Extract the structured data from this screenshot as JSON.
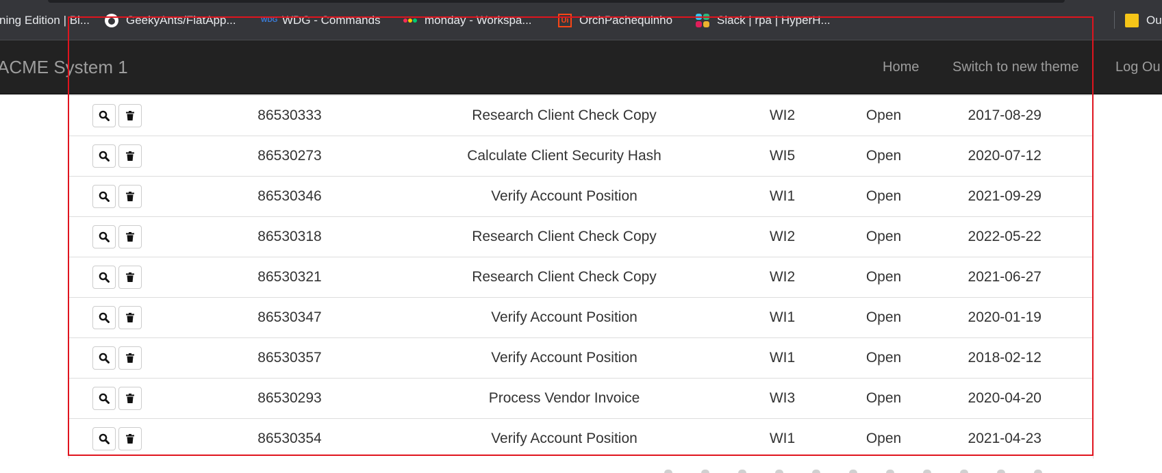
{
  "bookmarks": [
    {
      "label": "ning Edition | Bl...",
      "icon": "bookmark-icon"
    },
    {
      "label": "GeekyAnts/FlatApp...",
      "icon": "github-icon"
    },
    {
      "label": "WDG - Commands",
      "icon": "wdg-icon"
    },
    {
      "label": "monday - Workspa...",
      "icon": "monday-icon"
    },
    {
      "label": "OrchPachequinho",
      "icon": "uipath-icon"
    },
    {
      "label": "Slack | rpa | HyperH...",
      "icon": "slack-icon"
    },
    {
      "label": "Ou",
      "icon": "folder-icon"
    }
  ],
  "navbar": {
    "brand": "ACME System 1",
    "home": "Home",
    "switch_theme": "Switch to new theme",
    "logout": "Log Ou"
  },
  "rows": [
    {
      "id": "86530333",
      "description": "Research Client Check Copy",
      "type": "WI2",
      "status": "Open",
      "date": "2017-08-29"
    },
    {
      "id": "86530273",
      "description": "Calculate Client Security Hash",
      "type": "WI5",
      "status": "Open",
      "date": "2020-07-12"
    },
    {
      "id": "86530346",
      "description": "Verify Account Position",
      "type": "WI1",
      "status": "Open",
      "date": "2021-09-29"
    },
    {
      "id": "86530318",
      "description": "Research Client Check Copy",
      "type": "WI2",
      "status": "Open",
      "date": "2022-05-22"
    },
    {
      "id": "86530321",
      "description": "Research Client Check Copy",
      "type": "WI2",
      "status": "Open",
      "date": "2021-06-27"
    },
    {
      "id": "86530347",
      "description": "Verify Account Position",
      "type": "WI1",
      "status": "Open",
      "date": "2020-01-19"
    },
    {
      "id": "86530357",
      "description": "Verify Account Position",
      "type": "WI1",
      "status": "Open",
      "date": "2018-02-12"
    },
    {
      "id": "86530293",
      "description": "Process Vendor Invoice",
      "type": "WI3",
      "status": "Open",
      "date": "2020-04-20"
    },
    {
      "id": "86530354",
      "description": "Verify Account Position",
      "type": "WI1",
      "status": "Open",
      "date": "2021-04-23"
    }
  ],
  "colors": {
    "navbar_bg": "#222222",
    "bookmarks_bg": "#35363a",
    "annotation_red": "#e0141e"
  }
}
